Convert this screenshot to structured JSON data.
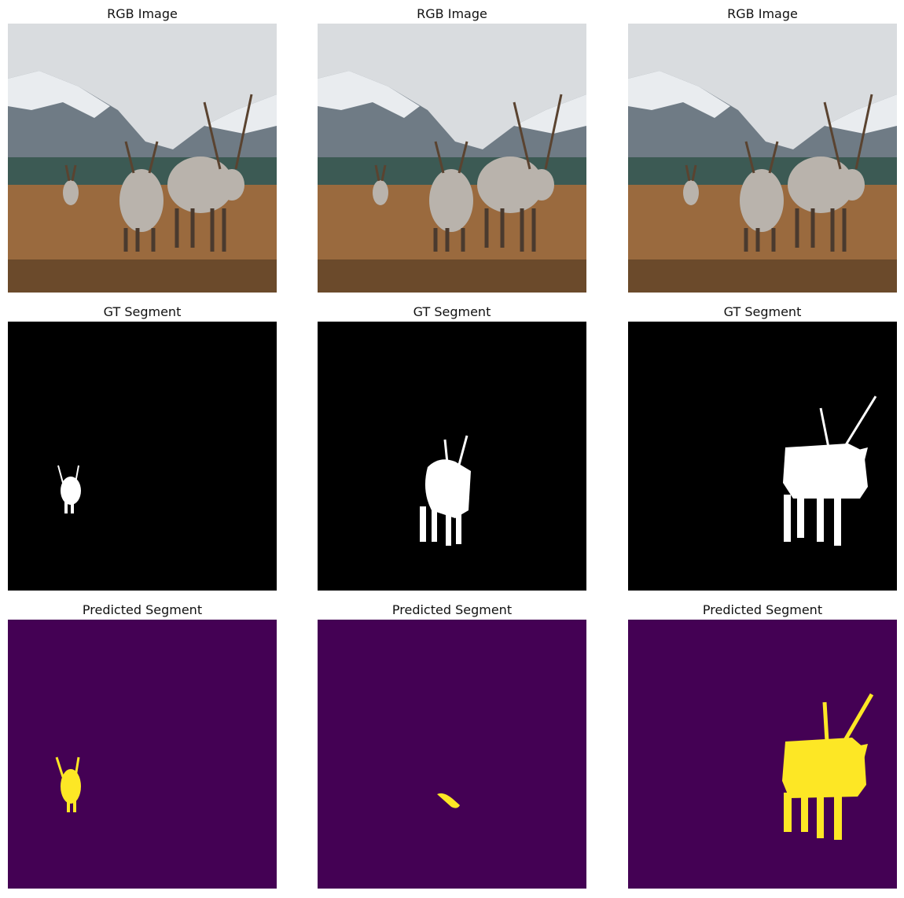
{
  "figure": {
    "columns": 3,
    "rows": [
      {
        "kind": "rgb",
        "titles": [
          "RGB Image",
          "RGB Image",
          "RGB Image"
        ]
      },
      {
        "kind": "gt",
        "titles": [
          "GT Segment",
          "GT Segment",
          "GT Segment"
        ]
      },
      {
        "kind": "pred",
        "titles": [
          "Predicted Segment",
          "Predicted Segment",
          "Predicted Segment"
        ]
      }
    ],
    "colors": {
      "gt_background": "#000000",
      "gt_foreground": "#ffffff",
      "pred_background": "#440154",
      "pred_foreground": "#fde725",
      "sky": "#d9dcdf",
      "mountain_snow": "#e9ecef",
      "mountain_rock": "#6f7b85",
      "forest": "#3c5a54",
      "field": "#9a6a3e"
    }
  }
}
